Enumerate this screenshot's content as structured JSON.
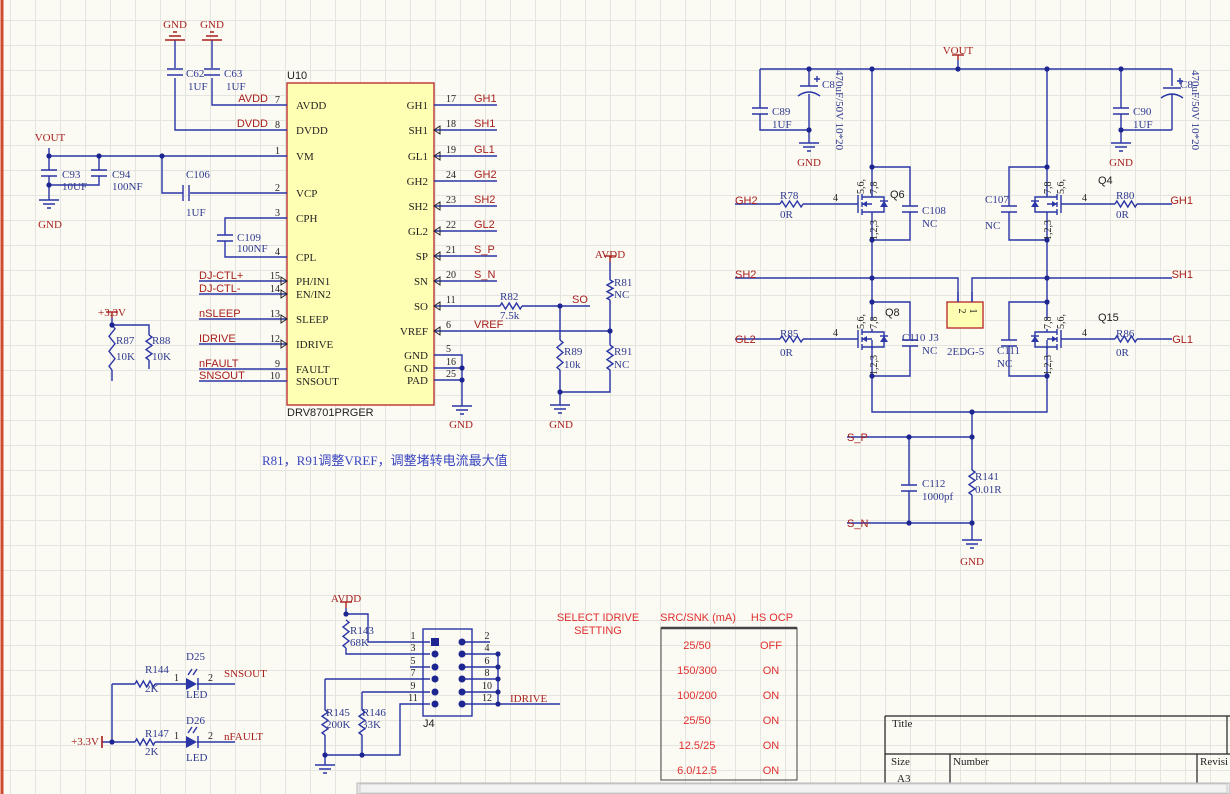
{
  "u10": {
    "designator": "U10",
    "part": "DRV8701PRGER",
    "left_pins": [
      {
        "name": "AVDD",
        "num": "7",
        "net": "AVDD"
      },
      {
        "name": "DVDD",
        "num": "8",
        "net": "DVDD"
      },
      {
        "name": "VM",
        "num": "1"
      },
      {
        "name": "VCP",
        "num": "2"
      },
      {
        "name": "CPH",
        "num": "3"
      },
      {
        "name": "CPL",
        "num": "4"
      },
      {
        "name": "PH/IN1",
        "num": "15",
        "net": "DJ-CTL+"
      },
      {
        "name": "EN/IN2",
        "num": "14",
        "net": "DJ-CTL-"
      },
      {
        "name": "SLEEP",
        "num": "13",
        "net": "nSLEEP"
      },
      {
        "name": "IDRIVE",
        "num": "12",
        "net": "IDRIVE"
      },
      {
        "name": "FAULT",
        "num": "9",
        "net": "nFAULT"
      },
      {
        "name": "SNSOUT",
        "num": "10",
        "net": "SNSOUT"
      }
    ],
    "right_pins": [
      {
        "name": "GH1",
        "num": "17",
        "net": "GH1"
      },
      {
        "name": "SH1",
        "num": "18",
        "net": "SH1"
      },
      {
        "name": "GL1",
        "num": "19",
        "net": "GL1"
      },
      {
        "name": "GH2",
        "num": "24",
        "net": "GH2"
      },
      {
        "name": "SH2",
        "num": "23",
        "net": "SH2"
      },
      {
        "name": "GL2",
        "num": "22",
        "net": "GL2"
      },
      {
        "name": "SP",
        "num": "21",
        "net": "S_P"
      },
      {
        "name": "SN",
        "num": "20",
        "net": "S_N"
      },
      {
        "name": "SO",
        "num": "11"
      },
      {
        "name": "VREF",
        "num": "6",
        "net": "VREF"
      },
      {
        "name": "GND",
        "num": "5"
      },
      {
        "name": "GND",
        "num": "16"
      },
      {
        "name": "PAD",
        "num": "25"
      }
    ]
  },
  "parts": [
    {
      "ref": "C62",
      "value": "1UF"
    },
    {
      "ref": "C63",
      "value": "1UF"
    },
    {
      "ref": "C93",
      "value": "10UF"
    },
    {
      "ref": "C94",
      "value": "100NF"
    },
    {
      "ref": "C106",
      "value": "1UF"
    },
    {
      "ref": "C109",
      "value": "100NF"
    },
    {
      "ref": "R87",
      "value": "10K"
    },
    {
      "ref": "R88",
      "value": "10K"
    },
    {
      "ref": "R82",
      "value": "7.5k"
    },
    {
      "ref": "R81",
      "value": "NC"
    },
    {
      "ref": "R89",
      "value": "10k"
    },
    {
      "ref": "R91",
      "value": "NC"
    },
    {
      "ref": "C8",
      "value": "470uF/50V 10*20"
    },
    {
      "ref": "C89",
      "value": "1UF"
    },
    {
      "ref": "C8",
      "value": "470uF/50V 10*20"
    },
    {
      "ref": "C90",
      "value": "1UF"
    },
    {
      "ref": "Q6"
    },
    {
      "ref": "R78",
      "value": "0R"
    },
    {
      "ref": "C108",
      "value": "NC"
    },
    {
      "ref": "C107",
      "value": "NC"
    },
    {
      "ref": "Q4"
    },
    {
      "ref": "R80",
      "value": "0R"
    },
    {
      "ref": "Q8"
    },
    {
      "ref": "R85",
      "value": "0R"
    },
    {
      "ref": "C110",
      "value": "NC"
    },
    {
      "ref": "J3",
      "value": "2EDG-5"
    },
    {
      "ref": "C111",
      "value": "NC"
    },
    {
      "ref": "Q15"
    },
    {
      "ref": "R86",
      "value": "0R"
    },
    {
      "ref": "C112",
      "value": "1000pf"
    },
    {
      "ref": "R141",
      "value": "0.01R"
    },
    {
      "ref": "R143",
      "value": "68K"
    },
    {
      "ref": "R145",
      "value": "200K"
    },
    {
      "ref": "R146",
      "value": "33K"
    },
    {
      "ref": "J4"
    },
    {
      "ref": "R144",
      "value": "2K"
    },
    {
      "ref": "D25",
      "value": "LED"
    },
    {
      "ref": "R147",
      "value": "2K"
    },
    {
      "ref": "D26",
      "value": "LED"
    }
  ],
  "nets": [
    "GND",
    "GND",
    "VOUT",
    "GND",
    "+3.3V",
    "GND",
    "GND",
    "AVDD",
    "SO",
    "VOUT",
    "GND",
    "GND",
    "GH2",
    "GH1",
    "SH2",
    "SH1",
    "GL2",
    "GL1",
    "S_P",
    "S_N",
    "GND",
    "AVDD",
    "SNSOUT",
    "nFAULT",
    "+3.3V",
    "IDRIVE"
  ],
  "mosfet_pins": {
    "drain_a": "5,6,",
    "drain_b": "7,8",
    "source": "1,2,3",
    "gate": "4"
  },
  "j3_pins": [
    "2",
    "1"
  ],
  "j4_pins": [
    "1",
    "2",
    "3",
    "4",
    "5",
    "6",
    "7",
    "8",
    "9",
    "10",
    "11",
    "12"
  ],
  "led_pins": [
    "1",
    "2"
  ],
  "note": "R81，R91调整VREF，调整堵转电流最大值",
  "idrive_table": {
    "title": "SELECT IDRIVE",
    "title2": "SETTING",
    "columns": [
      "SRC/SNK (mA)",
      "HS OCP"
    ],
    "rows": [
      [
        "25/50",
        "OFF"
      ],
      [
        "150/300",
        "ON"
      ],
      [
        "100/200",
        "ON"
      ],
      [
        "25/50",
        "ON"
      ],
      [
        "12.5/25",
        "ON"
      ],
      [
        "6.0/12.5",
        "ON"
      ]
    ]
  },
  "title_block": {
    "title": "Title",
    "size": "Size",
    "number": "Number",
    "revision": "Revisi",
    "size_value": "A3"
  },
  "scrollbar": {
    "thumb_label": "III"
  },
  "colors": {
    "wire": "#2a35a6",
    "net_label": "#a8201e",
    "component_text": "#2f3a8f",
    "ic_fill": "#ffffb4",
    "table_text": "#e03030"
  }
}
